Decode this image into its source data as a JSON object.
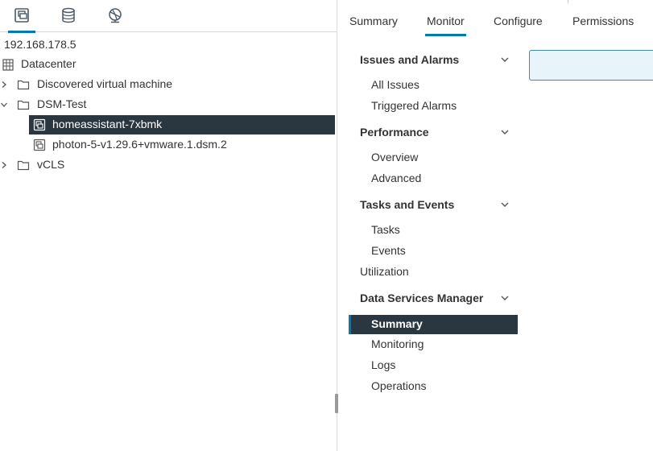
{
  "left": {
    "view_tabs": [
      {
        "icon": "vms-and-templates-icon",
        "active": true
      },
      {
        "icon": "storage-icon",
        "active": false
      },
      {
        "icon": "networking-icon",
        "active": false
      }
    ],
    "host": "192.168.178.5",
    "datacenter": "Datacenter",
    "tree": {
      "discovered": "Discovered virtual machine",
      "dsm_test": "DSM-Test",
      "homeassistant": "homeassistant-7xbmk",
      "photon": "photon-5-v1.29.6+vmware.1.dsm.2",
      "vcls": "vCLS"
    }
  },
  "right": {
    "tabs": {
      "summary": "Summary",
      "monitor": "Monitor",
      "configure": "Configure",
      "permissions": "Permissions"
    },
    "nav": {
      "issues_alarms": "Issues and Alarms",
      "all_issues": "All Issues",
      "triggered_alarms": "Triggered Alarms",
      "performance": "Performance",
      "overview": "Overview",
      "advanced": "Advanced",
      "tasks_events": "Tasks and Events",
      "tasks": "Tasks",
      "events": "Events",
      "utilization": "Utilization",
      "dsm": "Data Services Manager",
      "dsm_summary": "Summary",
      "monitoring": "Monitoring",
      "logs": "Logs",
      "operations": "Operations"
    }
  },
  "colors": {
    "accent": "#0079b8",
    "selected_bg": "#2a3640"
  }
}
